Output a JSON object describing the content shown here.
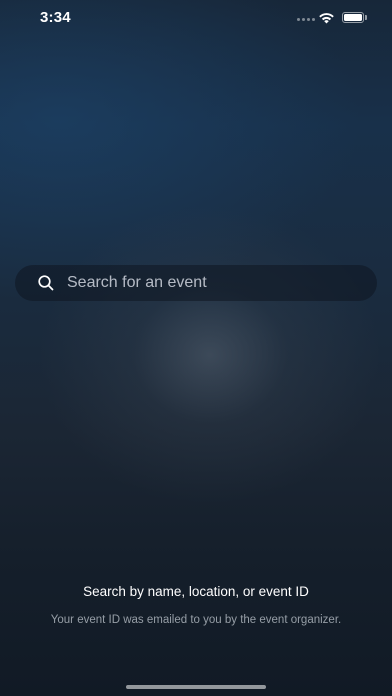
{
  "status_bar": {
    "time": "3:34",
    "icons": [
      "cellular-signal-icon",
      "wifi-icon",
      "battery-icon"
    ]
  },
  "search": {
    "placeholder": "Search for an event",
    "value": "",
    "icon": "search-icon"
  },
  "help": {
    "title": "Search by name, location, or event ID",
    "subtitle": "Your event ID was emailed to you by the event organizer."
  },
  "colors": {
    "background_top": "#18304a",
    "background_bottom": "#111a25",
    "text_primary": "#ffffff",
    "search_field_bg": "#121b27"
  }
}
